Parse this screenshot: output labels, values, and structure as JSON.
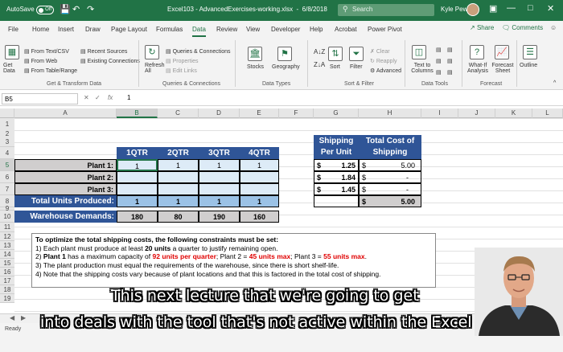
{
  "titlebar": {
    "autosave": "AutoSave",
    "toggle": "Off",
    "filename": "Excel103 - AdvancedExercises-working.xlsx",
    "date": "6/8/2018",
    "search_placeholder": "Search",
    "user": "Kyle Pew"
  },
  "menu": [
    "File",
    "Home",
    "Insert",
    "Draw",
    "Page Layout",
    "Formulas",
    "Data",
    "Review",
    "View",
    "Developer",
    "Help",
    "Acrobat",
    "Power Pivot"
  ],
  "menu_active": "Data",
  "share": "Share",
  "comments": "Comments",
  "ribbon": {
    "get_data": "Get Data",
    "from_text": "From Text/CSV",
    "from_web": "From Web",
    "from_table": "From Table/Range",
    "recent_sources": "Recent Sources",
    "existing_connections": "Existing Connections",
    "group_get": "Get & Transform Data",
    "refresh_all": "Refresh All",
    "queries": "Queries & Connections",
    "properties": "Properties",
    "edit_links": "Edit Links",
    "group_queries": "Queries & Connections",
    "stocks": "Stocks",
    "geography": "Geography",
    "group_types": "Data Types",
    "sort": "Sort",
    "filter": "Filter",
    "clear": "Clear",
    "reapply": "Reapply",
    "advanced": "Advanced",
    "group_sort": "Sort & Filter",
    "text_to_columns": "Text to Columns",
    "group_tools": "Data Tools",
    "what_if": "What-If Analysis",
    "forecast_sheet": "Forecast Sheet",
    "outline": "Outline",
    "group_forecast": "Forecast"
  },
  "formula_bar": {
    "name_box": "B5",
    "fx": "fx",
    "value": "1"
  },
  "columns": [
    "A",
    "B",
    "C",
    "D",
    "E",
    "F",
    "G",
    "H",
    "I",
    "J",
    "K",
    "L"
  ],
  "selected_column": "B",
  "rows": [
    "1",
    "2",
    "3",
    "4",
    "5",
    "6",
    "7",
    "8",
    "9",
    "10",
    "11",
    "12",
    "13",
    "14",
    "15",
    "16",
    "17",
    "18",
    "19"
  ],
  "selected_row": "5",
  "sheet": {
    "quarters": [
      "1QTR",
      "2QTR",
      "3QTR",
      "4QTR"
    ],
    "plants": [
      {
        "label": "Plant 1:",
        "values": [
          "1",
          "1",
          "1",
          "1"
        ]
      },
      {
        "label": "Plant 2:",
        "values": [
          "",
          "",
          "",
          ""
        ]
      },
      {
        "label": "Plant 3:",
        "values": [
          "",
          "",
          "",
          ""
        ]
      }
    ],
    "total_label": "Total Units Produced:",
    "total_values": [
      "1",
      "1",
      "1",
      "1"
    ],
    "demand_label": "Warehouse Demands:",
    "demand_values": [
      "180",
      "80",
      "190",
      "160"
    ],
    "shipping_header": [
      "Shipping",
      "Per Unit"
    ],
    "cost_header": [
      "Total Cost of",
      "Shipping"
    ],
    "shipping_rows": [
      {
        "cur1": "$",
        "rate": "1.25",
        "cur2": "$",
        "cost": "5.00"
      },
      {
        "cur1": "$",
        "rate": "1.84",
        "cur2": "$",
        "cost": "-"
      },
      {
        "cur1": "$",
        "rate": "1.45",
        "cur2": "$",
        "cost": "-"
      }
    ],
    "shipping_total": {
      "cur": "$",
      "cost": "5.00"
    }
  },
  "notes": {
    "title": "To optimize the total shipping costs, the following constraints must be set:",
    "line1_pre": "1)  Each plant must produce at least ",
    "line1_bold": "20 units",
    "line1_post": " a quarter to justify remaining open.",
    "line2_num": "2)  ",
    "line2_bold": "Plant 1",
    "line2_mid": " has a maximum capacity of ",
    "line2_red1": "92 units per quarter",
    "line2_mid2": "; Plant 2 = ",
    "line2_red2": "45 units max",
    "line2_mid3": "; Plant 3 = ",
    "line2_red3": "55 units max",
    "line2_end": ".",
    "line3": "3)  The plant production must equal the requirements of the warehouse, since there is short shelf-life.",
    "line4": "4)  Note that the shipping costs vary because of plant locations and that this is factored in the total cost of shipping."
  },
  "status": {
    "ready": "Ready"
  },
  "subtitles": [
    "This next lecture that we're going to get",
    "into deals with the tool that's not active within the Excel"
  ]
}
